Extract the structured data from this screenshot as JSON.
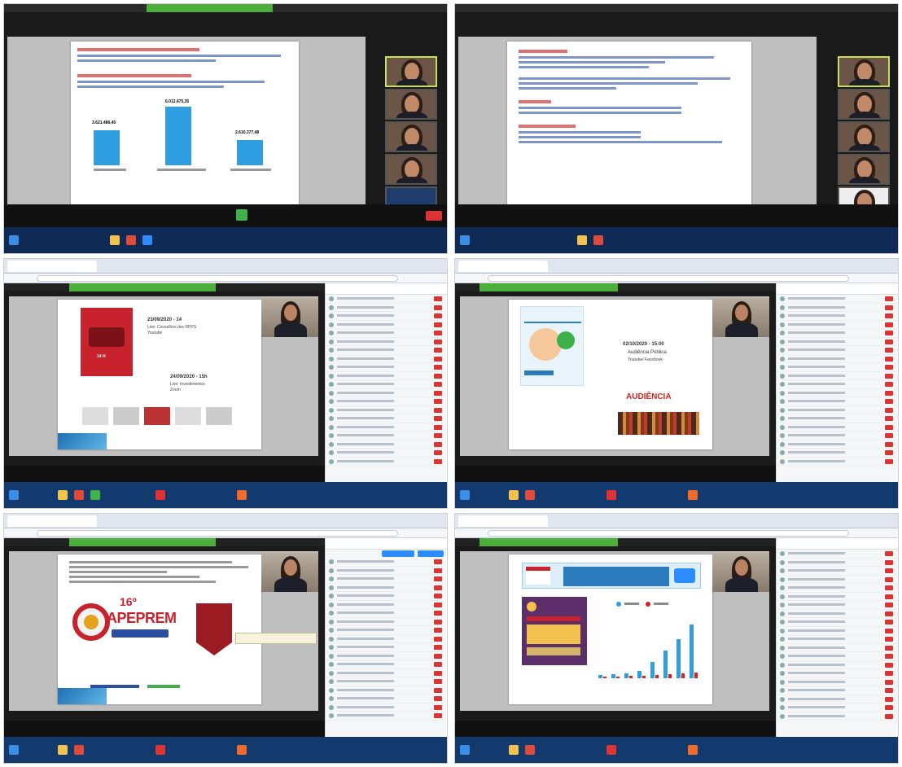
{
  "shot1": {
    "bar_labels": [
      "3.621.486,45",
      "6.012.475,35",
      "2.610.377,48"
    ],
    "bar_values": [
      3621486.45,
      6012475.35,
      2610377.48
    ]
  },
  "shot3": {
    "date1": "23/09/2020 - 14",
    "live1": "Live: Conselhos dos RPPS",
    "live1_platform": "Youtube",
    "date2": "24/09/2020 - 15h",
    "live2": "Live: Investimentos",
    "live2_platform": "Zoom",
    "poster_time": "14 H"
  },
  "shot4": {
    "date": "02/10/2020 - 15:00",
    "event": "Audiência Pública",
    "platform": "Youtube/ Facebook",
    "banner": "AUDIÊNCIA"
  },
  "shot5": {
    "edition": "16º",
    "brand": "APEPREM"
  },
  "colors": {
    "taskbar": "#0f2a55",
    "zoom_green": "#4caf3a",
    "accent_blue": "#2f9ee0",
    "accent_red": "#d0231d"
  }
}
